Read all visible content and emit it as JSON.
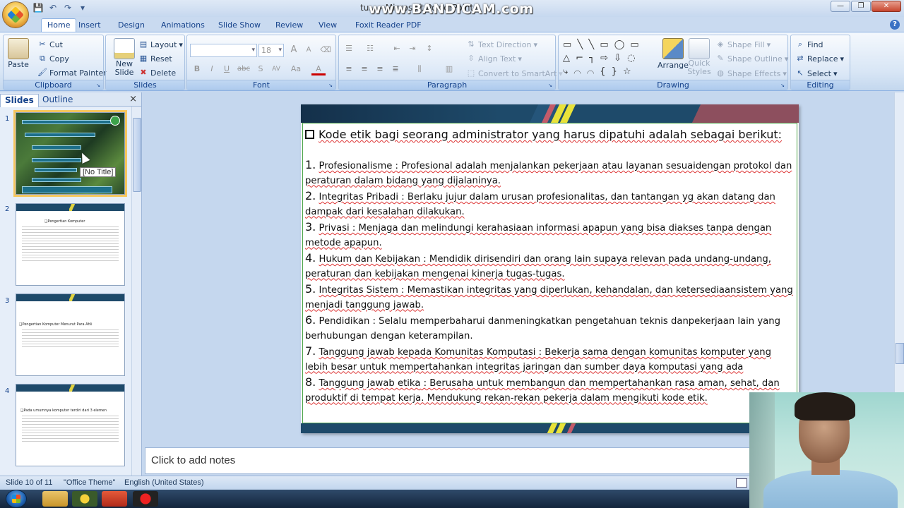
{
  "app": {
    "window_title": "tu... - Microsoft PowerPoint",
    "watermark": "www.BANDICAM.com"
  },
  "qat": {
    "save": "💾",
    "undo": "↶",
    "redo": "↷",
    "more": "▾"
  },
  "tabs": [
    "Home",
    "Insert",
    "Design",
    "Animations",
    "Slide Show",
    "Review",
    "View",
    "Foxit Reader PDF"
  ],
  "ribbon": {
    "clipboard": {
      "label": "Clipboard",
      "paste": "Paste",
      "cut": "Cut",
      "copy": "Copy",
      "format_painter": "Format Painter"
    },
    "slides": {
      "label": "Slides",
      "new_slide": "New Slide",
      "layout": "Layout",
      "reset": "Reset",
      "delete": "Delete"
    },
    "font": {
      "label": "Font",
      "font_name": "",
      "font_size": "18",
      "bold": "B",
      "italic": "I",
      "underline": "U",
      "strike": "abc",
      "shadow": "S",
      "spacing": "AV",
      "case": "Aa",
      "color": "A",
      "grow": "A",
      "shrink": "A"
    },
    "paragraph": {
      "label": "Paragraph",
      "text_direction": "Text Direction",
      "align_text": "Align Text",
      "convert_smartart": "Convert to SmartArt"
    },
    "drawing": {
      "label": "Drawing",
      "arrange": "Arrange",
      "quick_styles": "Quick Styles",
      "shape_fill": "Shape Fill",
      "shape_outline": "Shape Outline",
      "shape_effects": "Shape Effects"
    },
    "editing": {
      "label": "Editing",
      "find": "Find",
      "replace": "Replace",
      "select": "Select"
    }
  },
  "pane": {
    "tab_slides": "Slides",
    "tab_outline": "Outline",
    "close": "×",
    "tooltip": "[No Title]",
    "thumbs": [
      {
        "num": "1"
      },
      {
        "num": "2",
        "title": "❑Pengertian Komputer"
      },
      {
        "num": "3",
        "title": "❑Pengertian Komputer Menurut Para Ahli"
      },
      {
        "num": "4",
        "title": "❑Pada umumnya komputer terdiri dari 3 elemen"
      }
    ]
  },
  "slide": {
    "heading": "Kode etik bagi seorang administrator yang harus dipatuhi adalah sebagai berikut:",
    "items": [
      {
        "num": "1.",
        "term": "Profesionalisme",
        "text": " : Profesional adalah menjalankan pekerjaan atau layanan sesuaidengan protokol dan peraturan dalam bidang yang dijalaninya."
      },
      {
        "num": "2.",
        "term": "Integritas Pribadi",
        "text": " : Berlaku jujur dalam urusan profesionalitas, dan tantangan yg akan datang dan dampak dari kesalahan dilakukan."
      },
      {
        "num": "3.",
        "term": "Privasi",
        "text": " : Menjaga dan melindungi kerahasiaan informasi apapun yang bisa  diakses tanpa dengan metode apapun."
      },
      {
        "num": "4.",
        "term": " Hukum dan Kebijakan",
        "text": " : Mendidik dirisendiri dan orang lain supaya relevan pada undang-undang, peraturan dan kebijakan mengenai kinerja tugas-tugas."
      },
      {
        "num": "5.",
        "term": "Integritas Sistem",
        "text": " : Memastikan integritas yang diperlukan, kehandalan, dan ketersediaansistem yang menjadi tanggung jawab."
      },
      {
        "num": "6.",
        "term": "Pendidikan",
        "text": " : Selalu memperbaharui danmeningkatkan pengetahuan teknis danpekerjaan lain yang berhubungan dengan keterampilan."
      },
      {
        "num": "7.",
        "term": "Tanggung jawab kepada Komunitas Komputasi",
        "text": " : Bekerja sama dengan komunitas komputer yang lebih besar untuk mempertahankan integritas jaringan dan sumber daya komputasi yang ada"
      },
      {
        "num": "8.",
        "term": "Tanggung jawab etika",
        "text": " : Berusaha untuk membangun dan mempertahankan rasa aman, sehat, dan produktif di tempat kerja. Mendukung rekan-rekan pekerja dalam mengikuti kode etik."
      }
    ]
  },
  "notes_placeholder": "Click to add notes",
  "status": {
    "slide": "Slide 10 of 11",
    "theme": "\"Office Theme\"",
    "language": "English (United States)"
  },
  "colors": {
    "slide_bar": "#1e4a6a",
    "accent_yellow": "#e9e23a",
    "accent_red": "#c45b6a",
    "frame_green": "#4da44a"
  }
}
